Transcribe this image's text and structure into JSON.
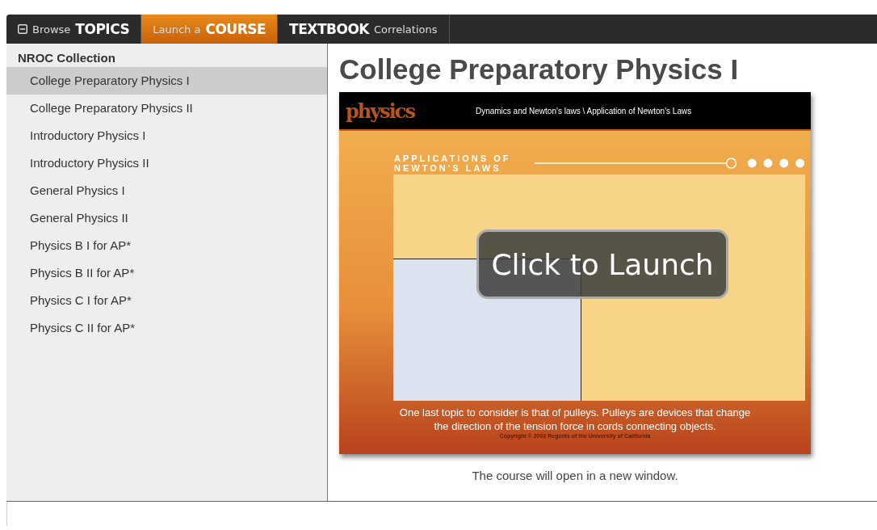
{
  "tabs": [
    {
      "parts": [
        {
          "text": "Browse",
          "bold": false
        },
        {
          "text": "TOPICS",
          "bold": true
        }
      ],
      "collapsible": true,
      "selected": false
    },
    {
      "parts": [
        {
          "text": "Launch a",
          "bold": false
        },
        {
          "text": "COURSE",
          "bold": true
        }
      ],
      "collapsible": false,
      "selected": true
    },
    {
      "parts": [
        {
          "text": "TEXTBOOK",
          "bold": true
        },
        {
          "text": "Correlations",
          "bold": false
        }
      ],
      "collapsible": false,
      "selected": false
    }
  ],
  "sidebar": {
    "heading": "NROC Collection",
    "items": [
      {
        "label": "College Preparatory Physics I",
        "selected": true
      },
      {
        "label": "College Preparatory Physics II",
        "selected": false
      },
      {
        "label": "Introductory Physics I",
        "selected": false
      },
      {
        "label": "Introductory Physics II",
        "selected": false
      },
      {
        "label": "General Physics I",
        "selected": false
      },
      {
        "label": "General Physics II",
        "selected": false
      },
      {
        "label": "Physics B I for AP*",
        "selected": false
      },
      {
        "label": "Physics B II for AP*",
        "selected": false
      },
      {
        "label": "Physics C I for AP*",
        "selected": false
      },
      {
        "label": "Physics C II for AP*",
        "selected": false
      }
    ]
  },
  "main": {
    "title": "College Preparatory Physics I",
    "preview": {
      "logo": "physics",
      "breadcrumb": "Dynamics and Newton's laws \\ Application of Newton's Laws",
      "lesson_title": "APPLICATIONS OF NEWTON'S LAWS",
      "launch": "Click to Launch",
      "caption": "One last topic to consider is that of pulleys. Pulleys are devices that change the direction of the tension force in cords connecting objects.",
      "copyright": "Copyright © 2003 Regents of the University of California"
    },
    "note": "The course will open in a new window."
  }
}
